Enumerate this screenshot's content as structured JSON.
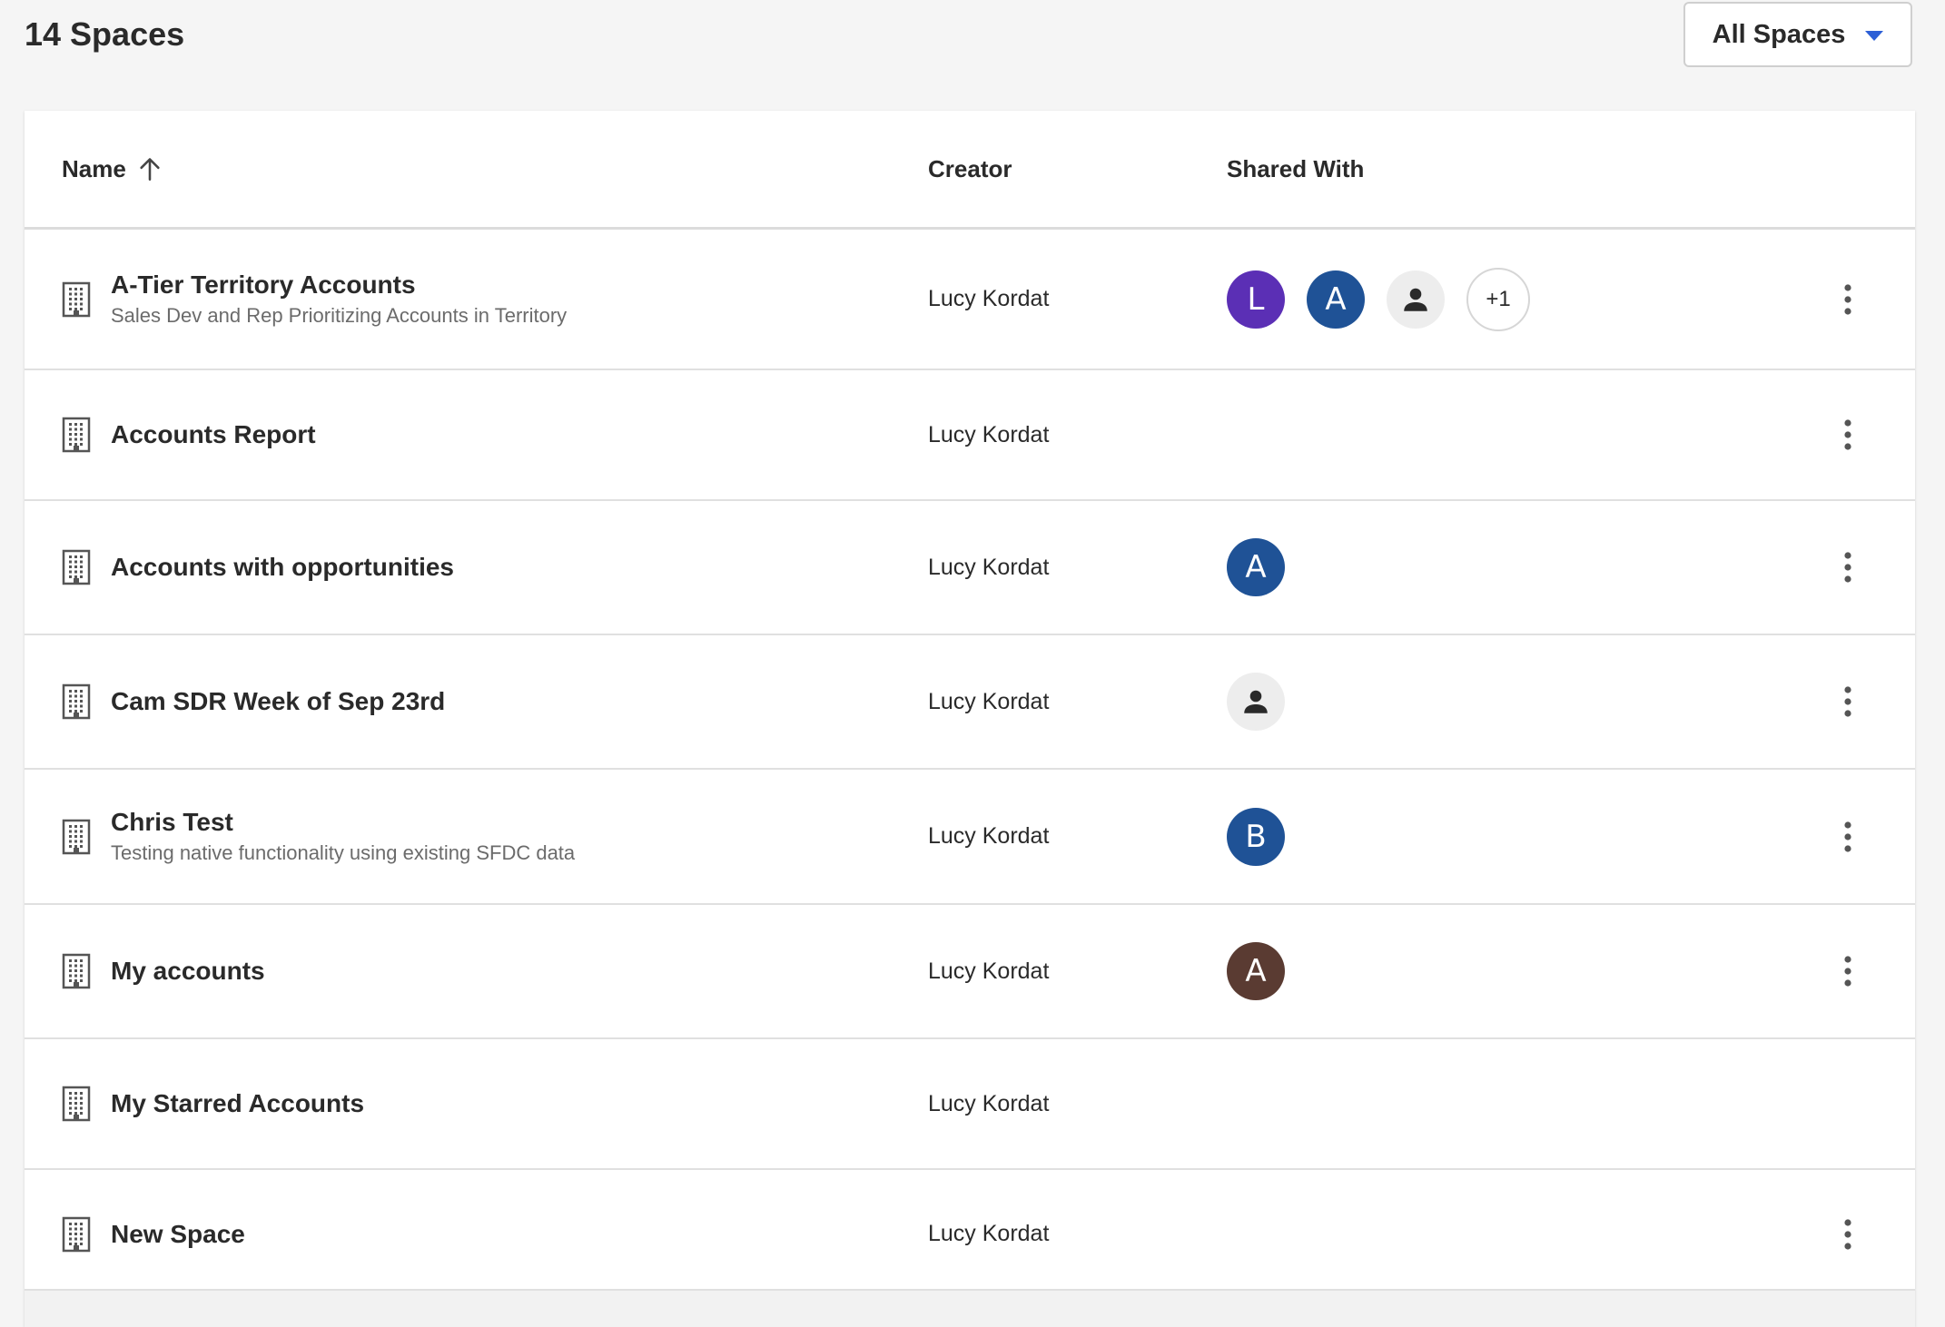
{
  "header": {
    "title": "14 Spaces",
    "filter_label": "All Spaces"
  },
  "table": {
    "columns": {
      "name": "Name",
      "creator": "Creator",
      "shared_with": "Shared With"
    },
    "rows": [
      {
        "title": "A-Tier Territory Accounts",
        "description": "Sales Dev and Rep Prioritizing Accounts in Territory",
        "creator": "Lucy Kordat",
        "shared": [
          {
            "type": "letter",
            "text": "L",
            "color": "#5b2fb5"
          },
          {
            "type": "letter",
            "text": "A",
            "color": "#1f5296"
          },
          {
            "type": "person-icon"
          },
          {
            "type": "more",
            "text": "+1"
          }
        ]
      },
      {
        "title": "Accounts Report",
        "description": "",
        "creator": "Lucy Kordat",
        "shared": []
      },
      {
        "title": "Accounts with opportunities",
        "description": "",
        "creator": "Lucy Kordat",
        "shared": [
          {
            "type": "letter",
            "text": "A",
            "color": "#1f5296"
          }
        ]
      },
      {
        "title": "Cam SDR Week of Sep 23rd",
        "description": "",
        "creator": "Lucy Kordat",
        "shared": [
          {
            "type": "person-icon"
          }
        ]
      },
      {
        "title": "Chris Test",
        "description": "Testing native functionality using existing SFDC data",
        "creator": "Lucy Kordat",
        "shared": [
          {
            "type": "letter",
            "text": "B",
            "color": "#1f5296"
          }
        ]
      },
      {
        "title": "My accounts",
        "description": "",
        "creator": "Lucy Kordat",
        "shared": [
          {
            "type": "letter",
            "text": "A",
            "color": "#5a3b32"
          }
        ]
      },
      {
        "title": "My Starred Accounts",
        "description": "",
        "creator": "Lucy Kordat",
        "shared": [],
        "no_menu": true
      },
      {
        "title": "New Space",
        "description": "",
        "creator": "Lucy Kordat",
        "shared": []
      }
    ]
  },
  "colors": {
    "accent": "#2c5fd6",
    "border": "#e0e0e0",
    "background": "#f5f5f5"
  }
}
